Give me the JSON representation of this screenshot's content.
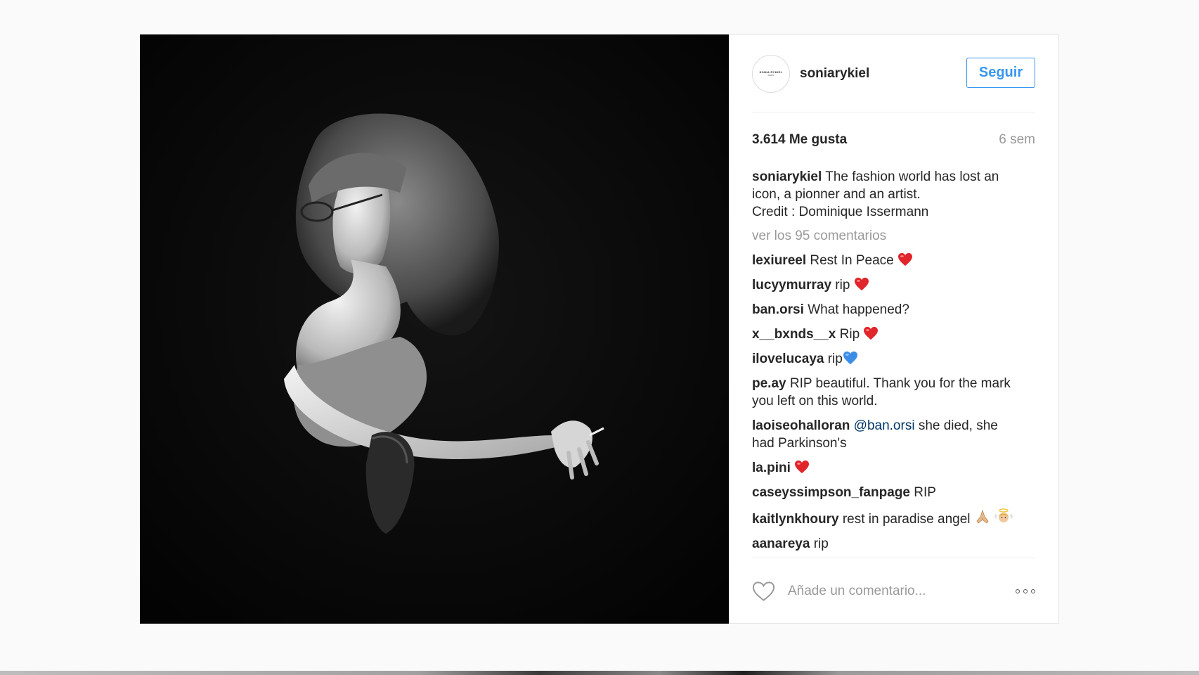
{
  "post": {
    "username": "soniarykiel",
    "avatar_text": "SONIA RYKIEL",
    "avatar_subtext": "PARIS",
    "follow_label": "Seguir",
    "likes": "3.614 Me gusta",
    "time": "6 sem",
    "caption": {
      "user": "soniarykiel",
      "line1": "The fashion world has lost an",
      "line2": "icon, a pionner and an artist.",
      "line3": "Credit : Dominique Issermann"
    },
    "view_all": "ver los 95 comentarios",
    "comment_placeholder": "Añade un comentario..."
  },
  "comments": [
    {
      "user": "lexiureel",
      "text": "Rest In Peace",
      "emoji": "red-heart"
    },
    {
      "user": "lucyymurray",
      "text": "rip",
      "emoji": "red-heart"
    },
    {
      "user": "ban.orsi",
      "text": "What happened?"
    },
    {
      "user": "x__bxnds__x",
      "text": "Rip",
      "emoji": "red-heart"
    },
    {
      "user": "ilovelucaya",
      "text": "rip",
      "emoji": "blue-heart"
    },
    {
      "user": "pe.ay",
      "text": "RIP beautiful. Thank you for the mark",
      "text2": "you left on this world."
    },
    {
      "user": "laoiseohalloran",
      "mention": "@ban.orsi",
      "text": "she died, she",
      "text2": "had Parkinson's"
    },
    {
      "user": "la.pini",
      "text": "",
      "emoji": "red-heart"
    },
    {
      "user": "caseyssimpson_fanpage",
      "text": "RIP"
    },
    {
      "user": "kaitlynkhoury",
      "text": "rest in paradise angel",
      "emoji": "praying-hands, angel"
    },
    {
      "user": "aanareya",
      "text": "rip"
    }
  ],
  "colors": {
    "accent": "#3897f0",
    "text": "#262626",
    "muted": "#999999",
    "mention": "#003569",
    "heart_red": "#e0262b",
    "heart_blue": "#3b8ee8"
  }
}
